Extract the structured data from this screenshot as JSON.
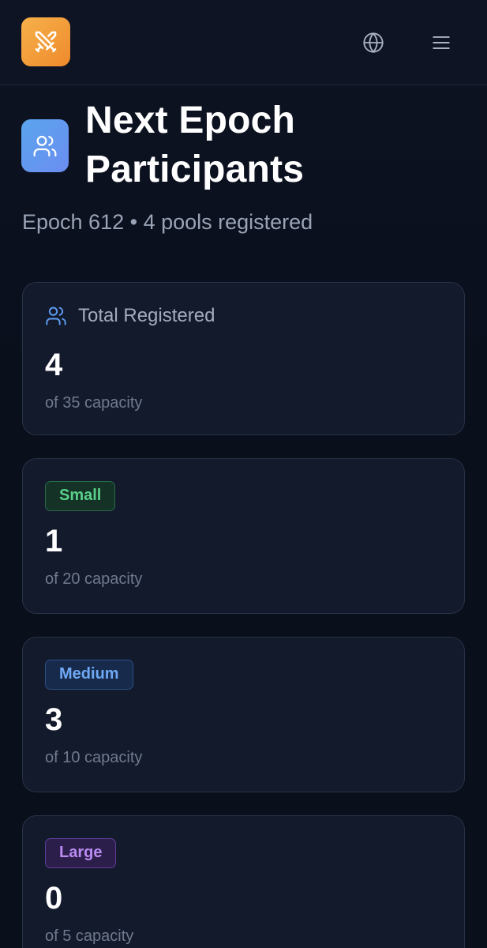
{
  "header": {
    "logo_icon": "crossed-swords-icon",
    "globe_icon": "globe-icon",
    "menu_icon": "hamburger-menu-icon"
  },
  "page": {
    "title_icon": "users-icon",
    "title": "Next Epoch Participants",
    "subtitle": "Epoch 612 • 4 pools registered"
  },
  "stats": {
    "total": {
      "icon": "users-icon",
      "label": "Total Registered",
      "value": "4",
      "capacity": "of 35 capacity"
    },
    "small": {
      "badge": "Small",
      "value": "1",
      "capacity": "of 20 capacity",
      "color": "#59d08a"
    },
    "medium": {
      "badge": "Medium",
      "value": "3",
      "capacity": "of 10 capacity",
      "color": "#6fa8f3"
    },
    "large": {
      "badge": "Large",
      "value": "0",
      "capacity": "of 5 capacity",
      "color": "#b98bf2"
    }
  },
  "colors": {
    "background": "#0a0f1c",
    "card": "#131a2c",
    "logo_accent": "#ef8a2c",
    "title_icon_accent": "#5aa5ee"
  }
}
